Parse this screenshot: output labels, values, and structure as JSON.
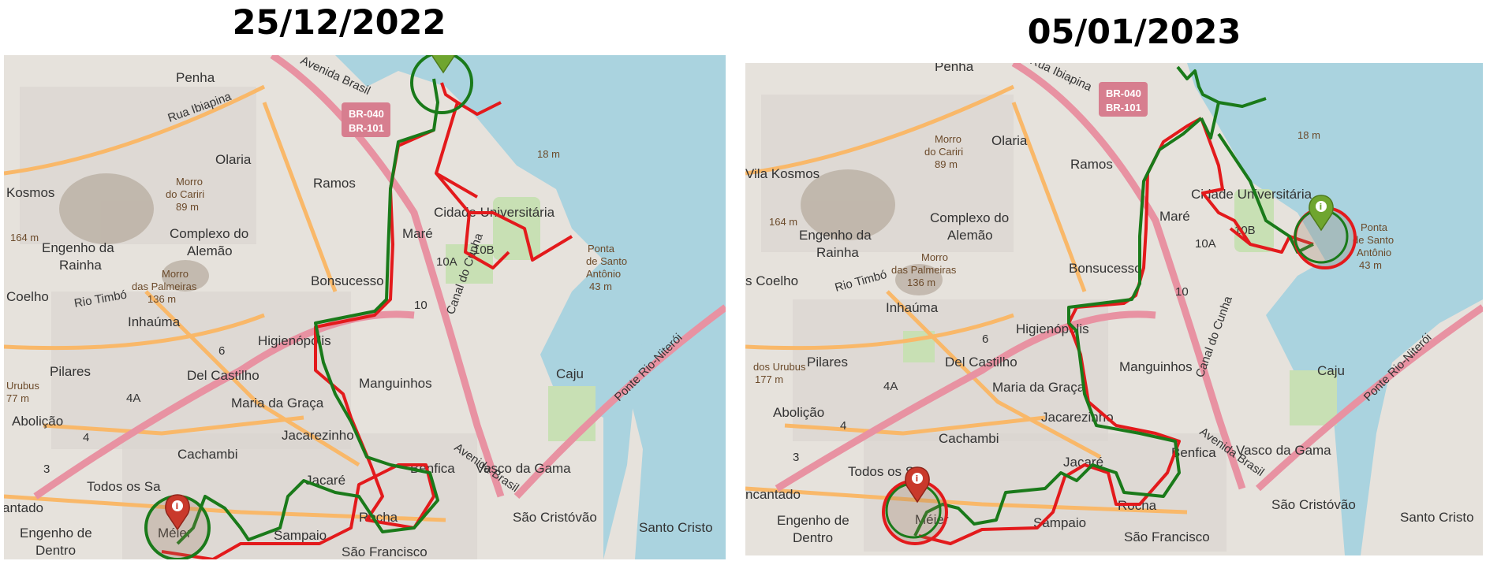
{
  "panels": [
    {
      "id": "left",
      "date": "25/12/2022",
      "labels": {
        "penha": "Penha",
        "olaria": "Olaria",
        "kosmos": "Kosmos",
        "ramos": "Ramos",
        "morro_cariri": "Morro",
        "morro_cariri2": "do Cariri",
        "morro_cariri_h": "89 m",
        "complexo": "Complexo do",
        "alemao": "Alemão",
        "engenho_rainha": "Engenho da",
        "rainha": "Rainha",
        "morro_palmeiras": "Morro",
        "palmeiras2": "das Palmeiras",
        "palmeiras_h": "136 m",
        "h164": "164 m",
        "coelho": "Coelho",
        "inhauma": "Inhaúma",
        "rio_timbo": "Rio Timbó",
        "bonsucesso": "Bonsucesso",
        "mare": "Maré",
        "cidade_univ": "Cidade Universitária",
        "higienopolis": "Higienópolis",
        "manguinhos": "Manguinhos",
        "del_castilho": "Del Castilho",
        "pilares": "Pilares",
        "urubus": "Urubus",
        "h77": "77 m",
        "abolicao": "Abolição",
        "maria_graca": "Maria da Graça",
        "jacarezinho": "Jacarezinho",
        "cachambi": "Cachambi",
        "todos_santos": "Todos os Sa",
        "jacare": "Jacaré",
        "benfica": "Benfica",
        "vasco": "Vasco da Gama",
        "caju": "Caju",
        "rocha": "Rocha",
        "sao_cristovao": "São Cristóvão",
        "santo_cristo": "Santo Cristo",
        "sampaio": "Sampaio",
        "sao_francisco": "São Francisco",
        "engenho_dentro": "Engenho de",
        "dentro": "Dentro",
        "meier": "Méier",
        "cantado": "antado",
        "ponta": "Ponta",
        "santo_antonio": "de Santo",
        "antonio2": "Antônio",
        "h43": "43 m",
        "h18": "18 m",
        "av_brasil": "Avenida Brasil",
        "rua_ibiapina": "Rua Ibiapina",
        "canal": "Canal do Cunha",
        "ponte": "Ponte Rio-Niterói",
        "r10": "10",
        "r10a": "10A",
        "r10b": "10B",
        "r6": "6",
        "r4a": "4A",
        "r4": "4",
        "r3": "3"
      },
      "shield": {
        "line1": "BR-040",
        "line2": "BR-101"
      }
    },
    {
      "id": "right",
      "date": "05/01/2023",
      "labels": {
        "penha": "Penha",
        "olaria": "Olaria",
        "kosmos": "Vila Kosmos",
        "ramos": "Ramos",
        "morro_cariri": "Morro",
        "morro_cariri2": "do Cariri",
        "morro_cariri_h": "89 m",
        "complexo": "Complexo do",
        "alemao": "Alemão",
        "engenho_rainha": "Engenho da",
        "rainha": "Rainha",
        "morro_palmeiras": "Morro",
        "palmeiras2": "das Palmeiras",
        "palmeiras_h": "136 m",
        "h164": "164 m",
        "coelho": "s Coelho",
        "inhauma": "Inhaúma",
        "rio_timbo": "Rio Timbó",
        "bonsucesso": "Bonsucesso",
        "mare": "Maré",
        "cidade_univ": "Cidade Universitária",
        "higienopolis": "Higienópolis",
        "manguinhos": "Manguinhos",
        "del_castilho": "Del Castilho",
        "pilares": "Pilares",
        "urubus": "dos Urubus",
        "h77": "177 m",
        "abolicao": "Abolição",
        "maria_graca": "Maria da Graça",
        "jacarezinho": "Jacarezinho",
        "cachambi": "Cachambi",
        "todos_santos": "Todos os Sa",
        "jacare": "Jacaré",
        "benfica": "Benfica",
        "vasco": "Vasco da Gama",
        "caju": "Caju",
        "rocha": "Rocha",
        "sao_cristovao": "São Cristóvão",
        "santo_cristo": "Santo Cristo",
        "sampaio": "Sampaio",
        "sao_francisco": "São Francisco",
        "engenho_dentro": "Engenho de",
        "dentro": "Dentro",
        "meier": "Méier",
        "cantado": "ncantado",
        "ponta": "Ponta",
        "santo_antonio": "de Santo",
        "antonio2": "Antônio",
        "h43": "43 m",
        "h18": "18 m",
        "av_brasil": "Avenida Brasil",
        "rua_ibiapina": "Rua Ibiapina",
        "canal": "Canal do Cunha",
        "ponte": "Ponte Rio-Niterói",
        "r10": "10",
        "r10a": "10A",
        "r10b": "10B",
        "r6": "6",
        "r4a": "4A",
        "r4": "4",
        "r3": "3"
      },
      "shield": {
        "line1": "BR-040",
        "line2": "BR-101"
      }
    }
  ],
  "colors": {
    "water": "#aad3df",
    "land": "#e6e2dc",
    "urban": "#dcd8d4",
    "primary_road": "#e892a2",
    "secondary_road": "#f9b869",
    "route_red": "#e31a1c",
    "route_green": "#1a7a1a",
    "marker_green": "#6fa52f",
    "marker_red": "#c9392b"
  }
}
